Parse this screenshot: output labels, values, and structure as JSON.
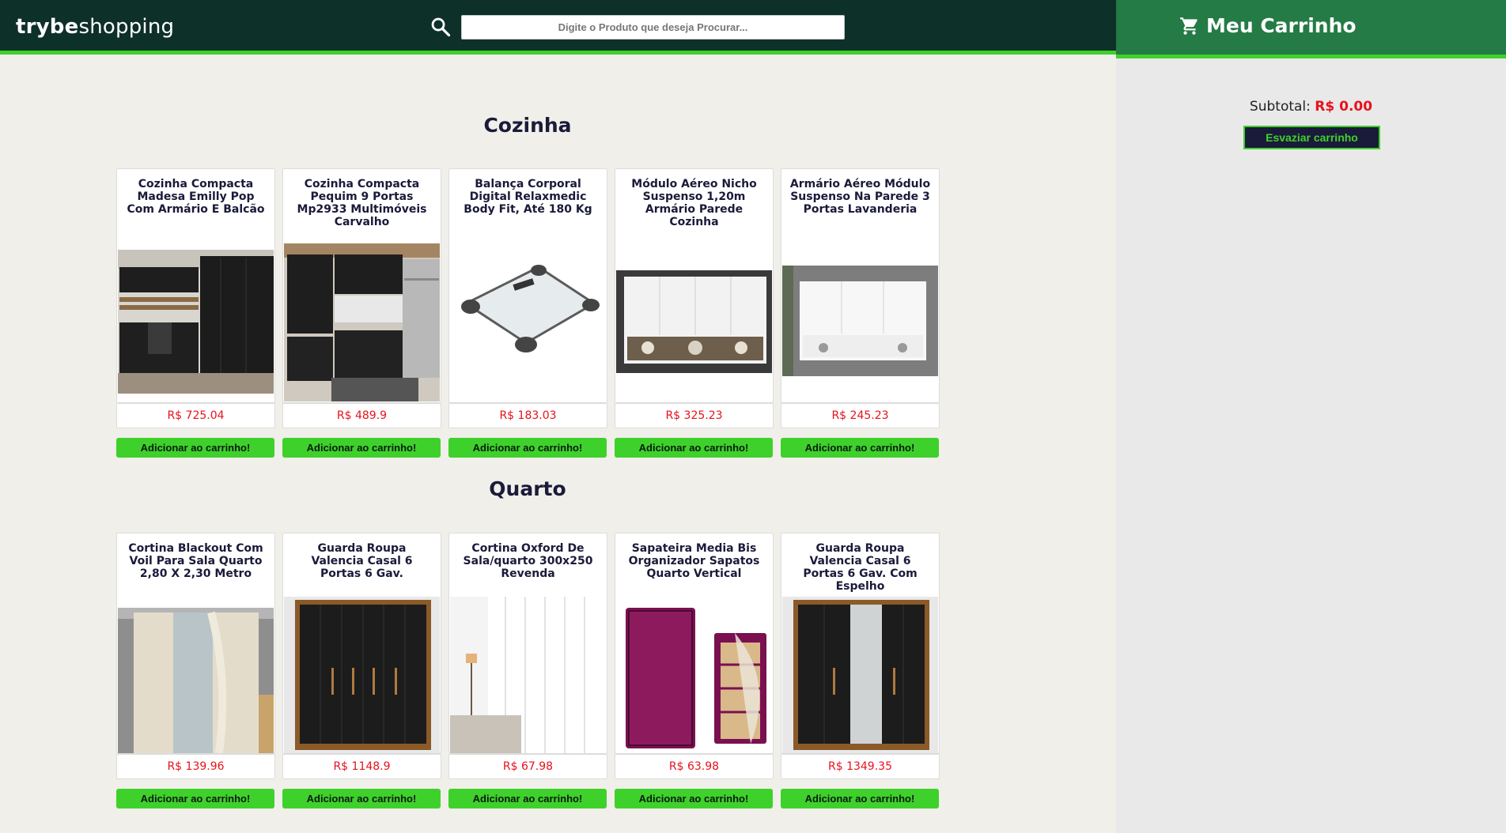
{
  "header": {
    "logo_bold": "trybe",
    "logo_regular": "shopping",
    "search_placeholder": "Digite o Produto que deseja Procurar...",
    "cart_title": "Meu Carrinho"
  },
  "cart": {
    "subtotal_label": "Subtotal:",
    "subtotal_value": "R$ 0.00",
    "empty_button": "Esvaziar carrinho"
  },
  "colors": {
    "header_bg": "#0d3029",
    "cart_header_bg": "#247b45",
    "accent_green": "#3fd12b",
    "price_red": "#e7121c"
  },
  "icons": {
    "search": "search-icon",
    "cart": "shopping-cart-icon"
  },
  "sections": [
    {
      "title": "Cozinha",
      "products": [
        {
          "title": "Cozinha Compacta Madesa Emilly Pop Com Armário E Balcão",
          "price": "R$ 725.04",
          "button": "Adicionar ao carrinho!",
          "image": "black-kitchen-cabinets"
        },
        {
          "title": "Cozinha Compacta Pequim 9 Portas Mp2933 Multimóveis Carvalho",
          "price": "R$ 489.9",
          "button": "Adicionar ao carrinho!",
          "image": "black-wood-kitchen"
        },
        {
          "title": "Balança Corporal Digital Relaxmedic Body Fit, Até 180 Kg",
          "price": "R$ 183.03",
          "button": "Adicionar ao carrinho!",
          "image": "glass-bathroom-scale"
        },
        {
          "title": "Módulo Aéreo Nicho Suspenso 1,20m Armário Parede Cozinha",
          "price": "R$ 325.23",
          "button": "Adicionar ao carrinho!",
          "image": "white-wall-cabinet"
        },
        {
          "title": "Armário Aéreo Módulo Suspenso Na Parede 3 Portas Lavanderia",
          "price": "R$ 245.23",
          "button": "Adicionar ao carrinho!",
          "image": "white-laundry-cabinet"
        }
      ]
    },
    {
      "title": "Quarto",
      "products": [
        {
          "title": "Cortina Blackout Com Voil Para Sala Quarto 2,80 X 2,30 Metro",
          "price": "R$ 139.96",
          "button": "Adicionar ao carrinho!",
          "image": "beige-curtain"
        },
        {
          "title": "Guarda Roupa Valencia Casal 6 Portas 6 Gav.",
          "price": "R$ 1148.9",
          "button": "Adicionar ao carrinho!",
          "image": "black-wardrobe"
        },
        {
          "title": "Cortina Oxford De Sala/quarto 300x250 Revenda",
          "price": "R$ 67.98",
          "button": "Adicionar ao carrinho!",
          "image": "white-curtain"
        },
        {
          "title": "Sapateira Media Bis Organizador Sapatos Quarto Vertical",
          "price": "R$ 63.98",
          "button": "Adicionar ao carrinho!",
          "image": "purple-shoe-rack"
        },
        {
          "title": "Guarda Roupa Valencia Casal 6 Portas 6 Gav. Com Espelho",
          "price": "R$ 1349.35",
          "button": "Adicionar ao carrinho!",
          "image": "wardrobe-with-mirror"
        }
      ]
    }
  ]
}
